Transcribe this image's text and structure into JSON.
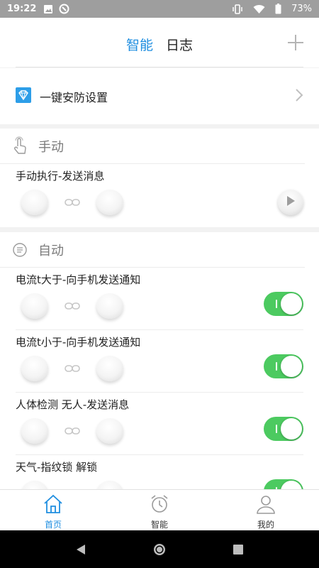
{
  "status_bar": {
    "time": "19:22",
    "battery": "73%"
  },
  "header": {
    "tabs": [
      {
        "label": "智能",
        "active": true
      },
      {
        "label": "日志",
        "active": false
      }
    ]
  },
  "security": {
    "label": "一键安防设置"
  },
  "manual": {
    "heading": "手动",
    "items": [
      {
        "title": "手动执行-发送消息"
      }
    ]
  },
  "auto": {
    "heading": "自动",
    "items": [
      {
        "title": "电流t大于-向手机发送通知",
        "enabled": true
      },
      {
        "title": "电流t小于-向手机发送通知",
        "enabled": true
      },
      {
        "title": "人体检测 无人-发送消息",
        "enabled": true
      },
      {
        "title": "天气-指纹锁 解锁",
        "enabled": true
      }
    ]
  },
  "bottom_nav": {
    "items": [
      {
        "label": "首页",
        "icon": "home-icon",
        "active": true
      },
      {
        "label": "智能",
        "icon": "alarm-clock-icon",
        "active": false
      },
      {
        "label": "我的",
        "icon": "person-icon",
        "active": false
      }
    ]
  },
  "colors": {
    "accent": "#1f8ee0",
    "toggle_on": "#4cca60"
  }
}
